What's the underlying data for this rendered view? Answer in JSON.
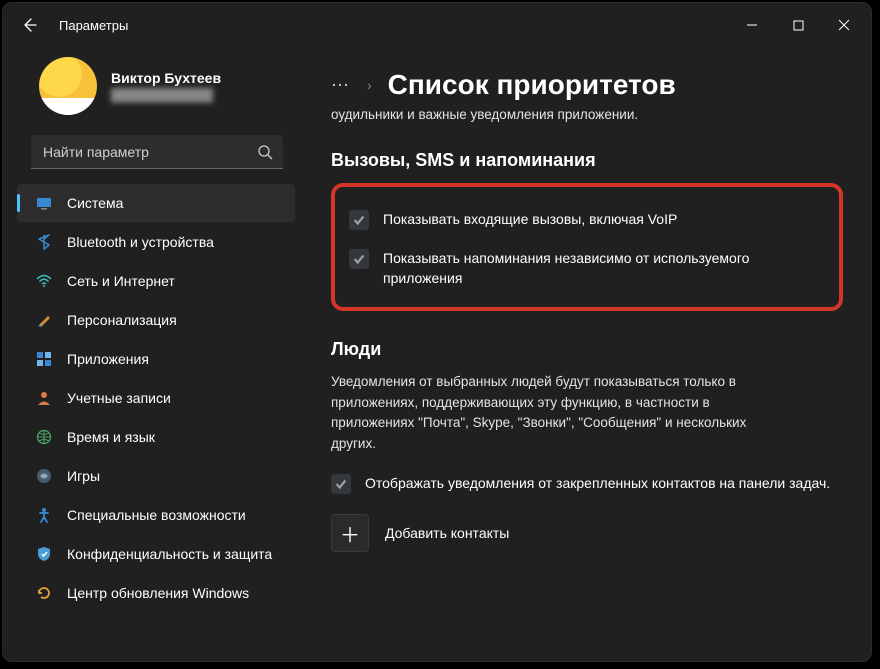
{
  "titlebar": {
    "app_name": "Параметры"
  },
  "profile": {
    "name": "Виктор Бухтеев",
    "email": "████████████"
  },
  "search": {
    "placeholder": "Найти параметр"
  },
  "nav": {
    "items": [
      {
        "id": "system",
        "label": "Система",
        "active": true
      },
      {
        "id": "bluetooth",
        "label": "Bluetooth и устройства",
        "active": false
      },
      {
        "id": "network",
        "label": "Сеть и Интернет",
        "active": false
      },
      {
        "id": "personalization",
        "label": "Персонализация",
        "active": false
      },
      {
        "id": "apps",
        "label": "Приложения",
        "active": false
      },
      {
        "id": "accounts",
        "label": "Учетные записи",
        "active": false
      },
      {
        "id": "time",
        "label": "Время и язык",
        "active": false
      },
      {
        "id": "gaming",
        "label": "Игры",
        "active": false
      },
      {
        "id": "accessibility",
        "label": "Специальные возможности",
        "active": false
      },
      {
        "id": "privacy",
        "label": "Конфиденциальность и защита",
        "active": false
      },
      {
        "id": "update",
        "label": "Центр обновления Windows",
        "active": false
      }
    ]
  },
  "breadcrumb": {
    "ellipsis": "⋯",
    "separator": "›",
    "title": "Список приоритетов"
  },
  "content": {
    "top_fragment": "оудильники и важные уведомления приложении.",
    "section1_title": "Вызовы, SMS и напоминания",
    "check1": "Показывать входящие вызовы, включая VoIP",
    "check2": "Показывать напоминания независимо от используемого приложения",
    "section2_title": "Люди",
    "people_desc": "Уведомления от выбранных людей будут показываться только в приложениях, поддерживающих эту функцию, в частности в приложениях \"Почта\", Skype, \"Звонки\", \"Сообщения\" и нескольких других.",
    "check3": "Отображать уведомления от закрепленных контактов на панели задач.",
    "add_contacts": "Добавить контакты"
  },
  "colors": {
    "accent": "#4cc2ff",
    "highlight_border": "#d33628"
  }
}
